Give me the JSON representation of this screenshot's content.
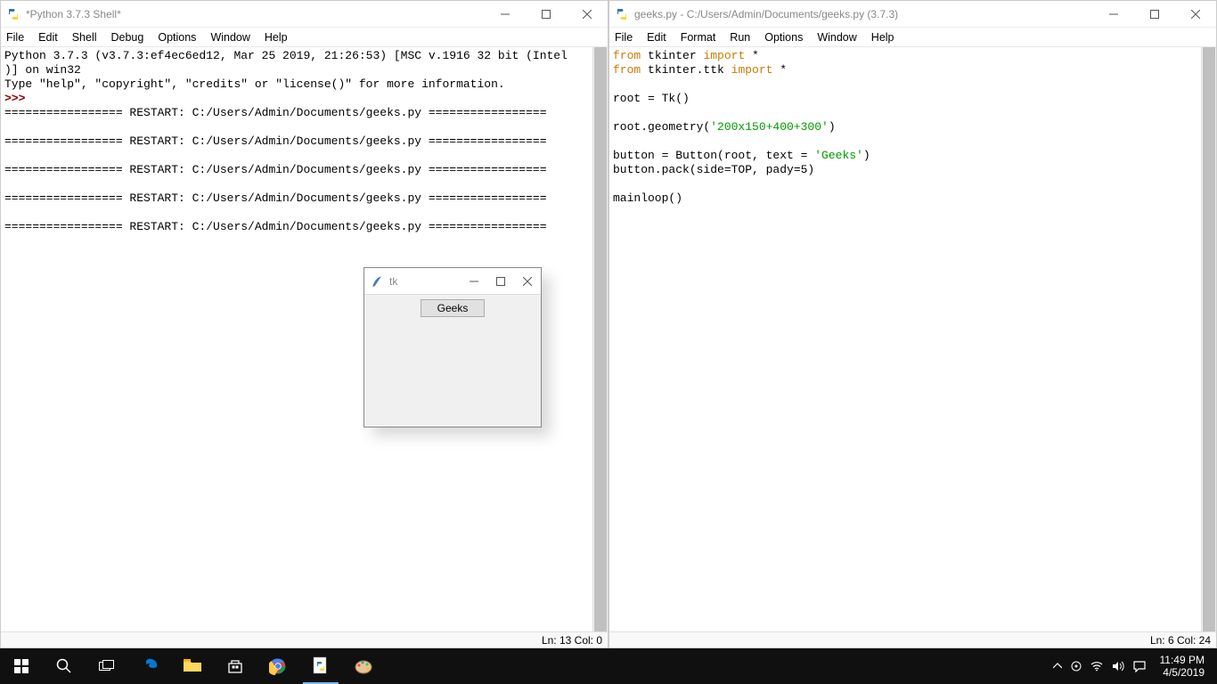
{
  "shell": {
    "title": "*Python 3.7.3 Shell*",
    "menus": [
      "File",
      "Edit",
      "Shell",
      "Debug",
      "Options",
      "Window",
      "Help"
    ],
    "banner_line1": "Python 3.7.3 (v3.7.3:ef4ec6ed12, Mar 25 2019, 21:26:53) [MSC v.1916 32 bit (Intel",
    "banner_line2": ")] on win32",
    "banner_line3": "Type \"help\", \"copyright\", \"credits\" or \"license()\" for more information.",
    "prompt": ">>>",
    "restart_line": "================= RESTART: C:/Users/Admin/Documents/geeks.py =================",
    "status": "Ln: 13  Col: 0"
  },
  "editor": {
    "title": "geeks.py - C:/Users/Admin/Documents/geeks.py (3.7.3)",
    "menus": [
      "File",
      "Edit",
      "Format",
      "Run",
      "Options",
      "Window",
      "Help"
    ],
    "code": {
      "l1_a": "from",
      "l1_b": " tkinter ",
      "l1_c": "import",
      "l1_d": " *",
      "l2_a": "from",
      "l2_b": " tkinter.ttk ",
      "l2_c": "import",
      "l2_d": " *",
      "l3": "",
      "l4": "root = Tk()",
      "l5": "",
      "l6_a": "root.geometry(",
      "l6_b": "'200x150+400+300'",
      "l6_c": ")",
      "l7": "",
      "l8_a": "button = Button(root, text = ",
      "l8_b": "'Geeks'",
      "l8_c": ")",
      "l9": "button.pack(side=TOP, pady=5)",
      "l10": "",
      "l11": "mainloop()"
    },
    "status": "Ln: 6  Col: 24"
  },
  "tk": {
    "title": "tk",
    "button": "Geeks"
  },
  "taskbar": {
    "time": "11:49 PM",
    "date": "4/5/2019"
  }
}
